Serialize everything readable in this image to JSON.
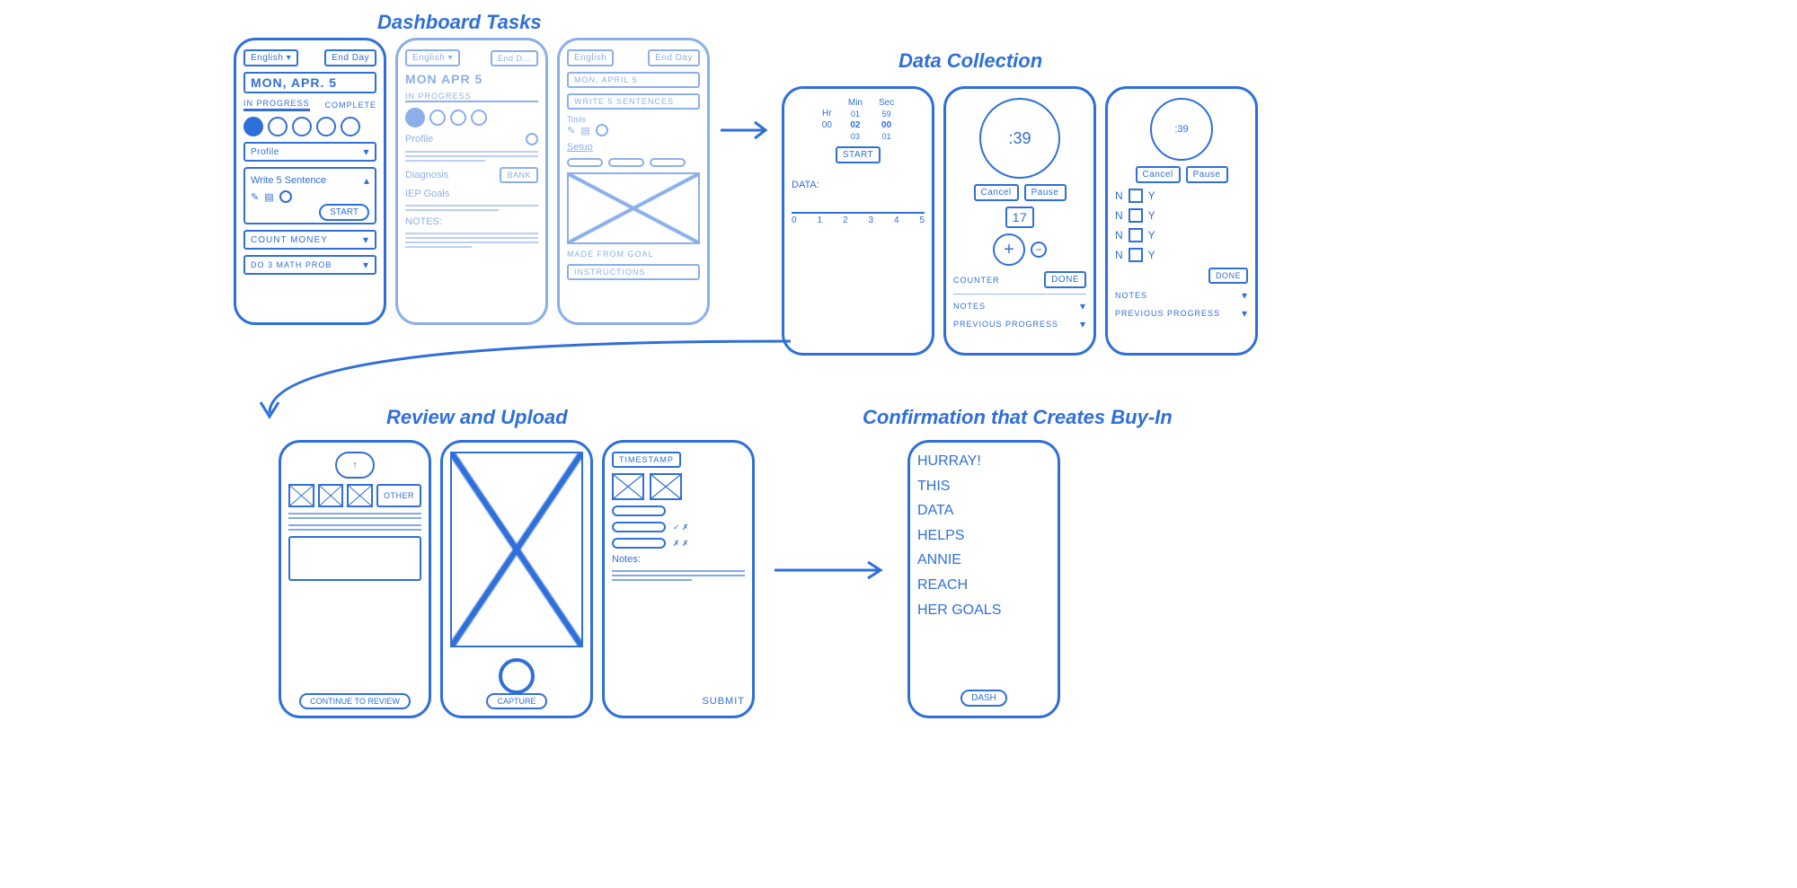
{
  "sections": {
    "dashboard": "Dashboard Tasks",
    "data_collection": "Data Collection",
    "review": "Review and Upload",
    "confirm": "Confirmation that Creates Buy-In"
  },
  "phone1": {
    "lang": "English ▾",
    "end": "End Day",
    "date": "MON, Apr. 5",
    "tab_in_progress": "IN PROGRESS",
    "tab_complete": "COMPLETE",
    "profile": "Profile",
    "task1_title": "Write 5 Sentence",
    "task1_start": "START",
    "task2": "COUNT MONEY",
    "task3": "DO 3 MATH PROB"
  },
  "phone2": {
    "lang": "English ▾",
    "end": "End D…",
    "date": "MON Apr 5",
    "tab_in_progress": "IN PROGRESS",
    "profile": "Profile",
    "diagnosis": "Diagnosis",
    "bank": "BANK",
    "iep": "IEP Goals",
    "notes": "NOTES:"
  },
  "phone3": {
    "lang": "English",
    "end": "End Day",
    "date": "MON, April 5",
    "header": "WRITE 5 SENTENCES",
    "tools": "Tools",
    "setup": "Setup",
    "made_from": "MADE FROM GOAL",
    "instructions": "INSTRUCTIONS"
  },
  "phone4": {
    "hr": "Hr",
    "min": "Min",
    "sec": "Sec",
    "hr_v": "00",
    "min_v0": "01",
    "min_v1": "02",
    "min_v2": "03",
    "sec_v0": "59",
    "sec_v1": "00",
    "sec_v2": "01",
    "start": "START",
    "data_label": "DATA:",
    "ticks": [
      "0",
      "1",
      "2",
      "3",
      "4",
      "5"
    ]
  },
  "phone5": {
    "time": ":39",
    "cancel": "Cancel",
    "pause": "Pause",
    "count": "17",
    "counter": "COUNTER",
    "done": "DONE",
    "notes": "NOTES",
    "prev": "PREVIOUS PROGRESS"
  },
  "phone6": {
    "time": ":39",
    "cancel": "Cancel",
    "pause": "Pause",
    "n": "N",
    "y": "Y",
    "done": "DONE",
    "notes": "NOTES",
    "prev": "PREVIOUS PROGRESS"
  },
  "phone7": {
    "other": "OTHER",
    "continue": "CONTINUE TO REVIEW"
  },
  "phone8": {
    "capture": "CAPTURE"
  },
  "phone9": {
    "timestamp": "TIMESTAMP",
    "notes": "Notes:",
    "submit": "SUBMIT"
  },
  "phone10": {
    "l1": "HURRAY!",
    "l2": "THIS",
    "l3": "DATA",
    "l4": "HELPS",
    "l5": "ANNIE",
    "l6": "REACH",
    "l7": "HER GOALS",
    "dash": "DASH"
  }
}
